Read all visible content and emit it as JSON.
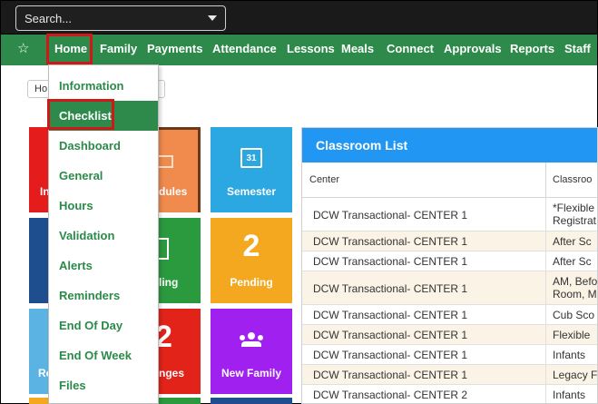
{
  "search": {
    "placeholder": "Search..."
  },
  "nav": {
    "items": [
      "Home",
      "Family",
      "Payments",
      "Attendance",
      "Lessons",
      "Meals",
      "Connect",
      "Approvals",
      "Reports",
      "Staff"
    ]
  },
  "breadcrumb": {
    "text": "Ho"
  },
  "home_menu": {
    "items": [
      "Information",
      "Checklist",
      "Dashboard",
      "General",
      "Hours",
      "Validation",
      "Alerts",
      "Reminders",
      "End Of Day",
      "End Of Week",
      "Files"
    ],
    "active": "Checklist"
  },
  "tiles": {
    "t1": "In",
    "t2": "dules",
    "t3": "Semester",
    "t3_icon_text": "31",
    "t5": "ling",
    "t6_num": "2",
    "t6": "Pending",
    "t7": "Re",
    "t8_num": "2",
    "t8": "nges",
    "t9": "New Family"
  },
  "classroom": {
    "title": "Classroom List",
    "columns": [
      "Center",
      "Classroo"
    ],
    "rows": [
      {
        "center": "DCW Transactional- CENTER 1",
        "classroom": [
          "*Flexible",
          "Registrat"
        ]
      },
      {
        "center": "DCW Transactional- CENTER 1",
        "classroom": [
          "After Sc"
        ]
      },
      {
        "center": "DCW Transactional- CENTER 1",
        "classroom": [
          "After Sc"
        ]
      },
      {
        "center": "DCW Transactional- CENTER 1",
        "classroom": [
          "AM, Befo",
          "Room, M"
        ]
      },
      {
        "center": "DCW Transactional- CENTER 1",
        "classroom": [
          "Cub Sco"
        ]
      },
      {
        "center": "DCW Transactional- CENTER 1",
        "classroom": [
          "Flexible"
        ]
      },
      {
        "center": "DCW Transactional- CENTER 1",
        "classroom": [
          "Infants"
        ]
      },
      {
        "center": "DCW Transactional- CENTER 1",
        "classroom": [
          "Legacy F"
        ]
      },
      {
        "center": "DCW Transactional- CENTER 2",
        "classroom": [
          "Infants"
        ]
      }
    ]
  },
  "colors": {
    "nav_green": "#2d8a4a",
    "panel_blue": "#2196f3",
    "highlight_red": "#d01818"
  }
}
